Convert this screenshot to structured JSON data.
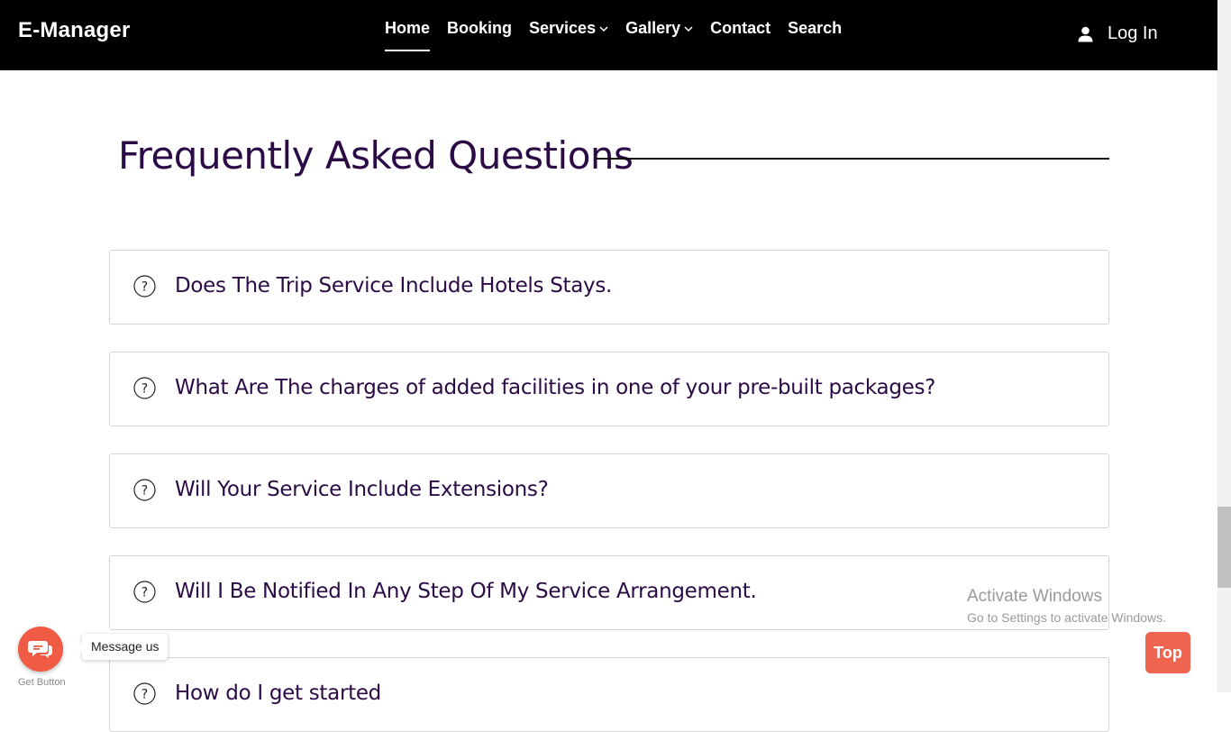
{
  "header": {
    "brand": "E-Manager",
    "nav": [
      {
        "label": "Home",
        "active": true
      },
      {
        "label": "Booking"
      },
      {
        "label": "Services",
        "dropdown": true
      },
      {
        "label": "Gallery",
        "dropdown": true
      },
      {
        "label": "Contact"
      },
      {
        "label": "Search"
      }
    ],
    "login_label": "Log In",
    "login_icon": "user-icon"
  },
  "faq": {
    "title": "Frequently Asked Questions",
    "items": [
      {
        "question": "Does The Trip Service Include Hotels Stays.",
        "icon": "question-circle-icon"
      },
      {
        "question": "What Are The charges of added facilities in one of your pre-built packages?",
        "icon": "question-circle-icon"
      },
      {
        "question": "Will Your Service Include Extensions?",
        "icon": "question-circle-icon"
      },
      {
        "question": "Will I Be Notified In Any Step Of My Service Arrangement.",
        "icon": "question-circle-icon"
      },
      {
        "question": "How do I get started",
        "icon": "question-circle-icon"
      }
    ]
  },
  "watermark": {
    "title": "Activate Windows",
    "subtitle": "Go to Settings to activate Windows."
  },
  "widget": {
    "message_label": "Message us",
    "get_button_label": "Get Button",
    "icon": "chat-bubbles-icon"
  },
  "back_to_top": {
    "label": "Top"
  },
  "colors": {
    "header_bg": "#000000",
    "heading": "#2b0a45",
    "accent": "#f06550"
  }
}
